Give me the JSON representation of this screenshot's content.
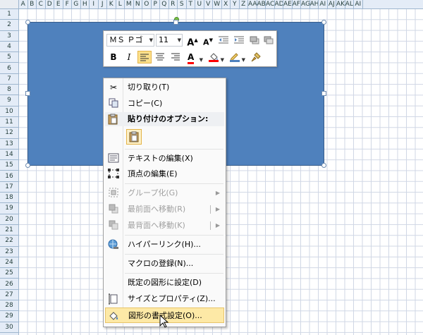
{
  "columns": [
    "A",
    "B",
    "C",
    "D",
    "E",
    "F",
    "G",
    "H",
    "I",
    "J",
    "K",
    "L",
    "M",
    "N",
    "O",
    "P",
    "Q",
    "R",
    "S",
    "T",
    "U",
    "V",
    "W",
    "X",
    "Y",
    "Z",
    "AA",
    "AB",
    "AC",
    "AD",
    "AE",
    "AF",
    "AG",
    "AH",
    "AI",
    "AJ",
    "AK",
    "AL",
    "AI"
  ],
  "rows": [
    "1",
    "2",
    "3",
    "4",
    "5",
    "6",
    "7",
    "8",
    "9",
    "10",
    "11",
    "12",
    "13",
    "14",
    "15",
    "16",
    "17",
    "18",
    "19",
    "20",
    "21",
    "22",
    "23",
    "24",
    "25",
    "26",
    "27",
    "28",
    "29",
    "30"
  ],
  "shape": {
    "fill": "#4f81bd",
    "border": "#385d8a"
  },
  "mini_toolbar": {
    "font_name": "ＭＳ Ｐゴ",
    "font_size": "11",
    "grow_font": "A",
    "shrink_font": "A",
    "bold": "B",
    "italic": "I",
    "font_color_glyph": "A",
    "font_color": "#ff0000",
    "fill_color": "#ff0000",
    "line_color": "#4f81bd"
  },
  "context_menu": {
    "cut": "切り取り(T)",
    "copy": "コピー(C)",
    "paste_options_header": "貼り付けのオプション:",
    "edit_text": "テキストの編集(X)",
    "edit_points": "頂点の編集(E)",
    "group": "グループ化(G)",
    "bring_to_front": "最前面へ移動(R)",
    "send_to_back": "最背面へ移動(K)",
    "hyperlink": "ハイパーリンク(H)...",
    "assign_macro": "マクロの登録(N)...",
    "set_default_shape": "既定の図形に設定(D)",
    "size_properties": "サイズとプロパティ(Z)...",
    "format_shape": "図形の書式設定(O)..."
  }
}
